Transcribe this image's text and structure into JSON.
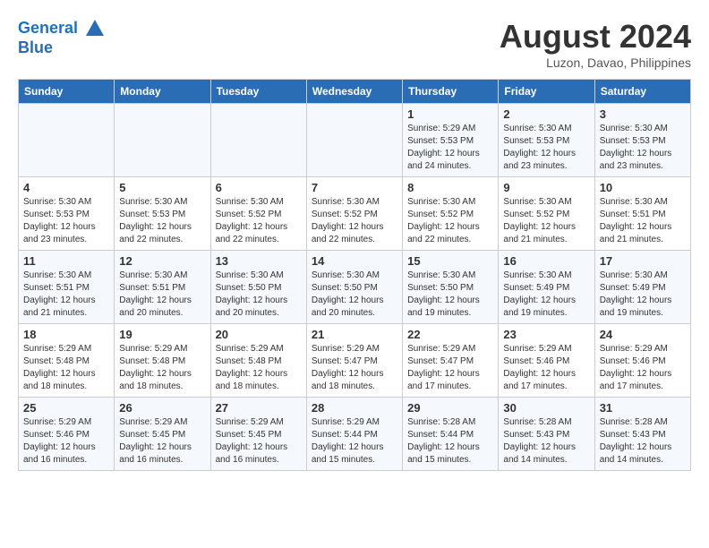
{
  "header": {
    "logo_line1": "General",
    "logo_line2": "Blue",
    "month_year": "August 2024",
    "location": "Luzon, Davao, Philippines"
  },
  "weekdays": [
    "Sunday",
    "Monday",
    "Tuesday",
    "Wednesday",
    "Thursday",
    "Friday",
    "Saturday"
  ],
  "weeks": [
    [
      {
        "day": "",
        "info": ""
      },
      {
        "day": "",
        "info": ""
      },
      {
        "day": "",
        "info": ""
      },
      {
        "day": "",
        "info": ""
      },
      {
        "day": "1",
        "info": "Sunrise: 5:29 AM\nSunset: 5:53 PM\nDaylight: 12 hours\nand 24 minutes."
      },
      {
        "day": "2",
        "info": "Sunrise: 5:30 AM\nSunset: 5:53 PM\nDaylight: 12 hours\nand 23 minutes."
      },
      {
        "day": "3",
        "info": "Sunrise: 5:30 AM\nSunset: 5:53 PM\nDaylight: 12 hours\nand 23 minutes."
      }
    ],
    [
      {
        "day": "4",
        "info": "Sunrise: 5:30 AM\nSunset: 5:53 PM\nDaylight: 12 hours\nand 23 minutes."
      },
      {
        "day": "5",
        "info": "Sunrise: 5:30 AM\nSunset: 5:53 PM\nDaylight: 12 hours\nand 22 minutes."
      },
      {
        "day": "6",
        "info": "Sunrise: 5:30 AM\nSunset: 5:52 PM\nDaylight: 12 hours\nand 22 minutes."
      },
      {
        "day": "7",
        "info": "Sunrise: 5:30 AM\nSunset: 5:52 PM\nDaylight: 12 hours\nand 22 minutes."
      },
      {
        "day": "8",
        "info": "Sunrise: 5:30 AM\nSunset: 5:52 PM\nDaylight: 12 hours\nand 22 minutes."
      },
      {
        "day": "9",
        "info": "Sunrise: 5:30 AM\nSunset: 5:52 PM\nDaylight: 12 hours\nand 21 minutes."
      },
      {
        "day": "10",
        "info": "Sunrise: 5:30 AM\nSunset: 5:51 PM\nDaylight: 12 hours\nand 21 minutes."
      }
    ],
    [
      {
        "day": "11",
        "info": "Sunrise: 5:30 AM\nSunset: 5:51 PM\nDaylight: 12 hours\nand 21 minutes."
      },
      {
        "day": "12",
        "info": "Sunrise: 5:30 AM\nSunset: 5:51 PM\nDaylight: 12 hours\nand 20 minutes."
      },
      {
        "day": "13",
        "info": "Sunrise: 5:30 AM\nSunset: 5:50 PM\nDaylight: 12 hours\nand 20 minutes."
      },
      {
        "day": "14",
        "info": "Sunrise: 5:30 AM\nSunset: 5:50 PM\nDaylight: 12 hours\nand 20 minutes."
      },
      {
        "day": "15",
        "info": "Sunrise: 5:30 AM\nSunset: 5:50 PM\nDaylight: 12 hours\nand 19 minutes."
      },
      {
        "day": "16",
        "info": "Sunrise: 5:30 AM\nSunset: 5:49 PM\nDaylight: 12 hours\nand 19 minutes."
      },
      {
        "day": "17",
        "info": "Sunrise: 5:30 AM\nSunset: 5:49 PM\nDaylight: 12 hours\nand 19 minutes."
      }
    ],
    [
      {
        "day": "18",
        "info": "Sunrise: 5:29 AM\nSunset: 5:48 PM\nDaylight: 12 hours\nand 18 minutes."
      },
      {
        "day": "19",
        "info": "Sunrise: 5:29 AM\nSunset: 5:48 PM\nDaylight: 12 hours\nand 18 minutes."
      },
      {
        "day": "20",
        "info": "Sunrise: 5:29 AM\nSunset: 5:48 PM\nDaylight: 12 hours\nand 18 minutes."
      },
      {
        "day": "21",
        "info": "Sunrise: 5:29 AM\nSunset: 5:47 PM\nDaylight: 12 hours\nand 18 minutes."
      },
      {
        "day": "22",
        "info": "Sunrise: 5:29 AM\nSunset: 5:47 PM\nDaylight: 12 hours\nand 17 minutes."
      },
      {
        "day": "23",
        "info": "Sunrise: 5:29 AM\nSunset: 5:46 PM\nDaylight: 12 hours\nand 17 minutes."
      },
      {
        "day": "24",
        "info": "Sunrise: 5:29 AM\nSunset: 5:46 PM\nDaylight: 12 hours\nand 17 minutes."
      }
    ],
    [
      {
        "day": "25",
        "info": "Sunrise: 5:29 AM\nSunset: 5:46 PM\nDaylight: 12 hours\nand 16 minutes."
      },
      {
        "day": "26",
        "info": "Sunrise: 5:29 AM\nSunset: 5:45 PM\nDaylight: 12 hours\nand 16 minutes."
      },
      {
        "day": "27",
        "info": "Sunrise: 5:29 AM\nSunset: 5:45 PM\nDaylight: 12 hours\nand 16 minutes."
      },
      {
        "day": "28",
        "info": "Sunrise: 5:29 AM\nSunset: 5:44 PM\nDaylight: 12 hours\nand 15 minutes."
      },
      {
        "day": "29",
        "info": "Sunrise: 5:28 AM\nSunset: 5:44 PM\nDaylight: 12 hours\nand 15 minutes."
      },
      {
        "day": "30",
        "info": "Sunrise: 5:28 AM\nSunset: 5:43 PM\nDaylight: 12 hours\nand 14 minutes."
      },
      {
        "day": "31",
        "info": "Sunrise: 5:28 AM\nSunset: 5:43 PM\nDaylight: 12 hours\nand 14 minutes."
      }
    ]
  ]
}
